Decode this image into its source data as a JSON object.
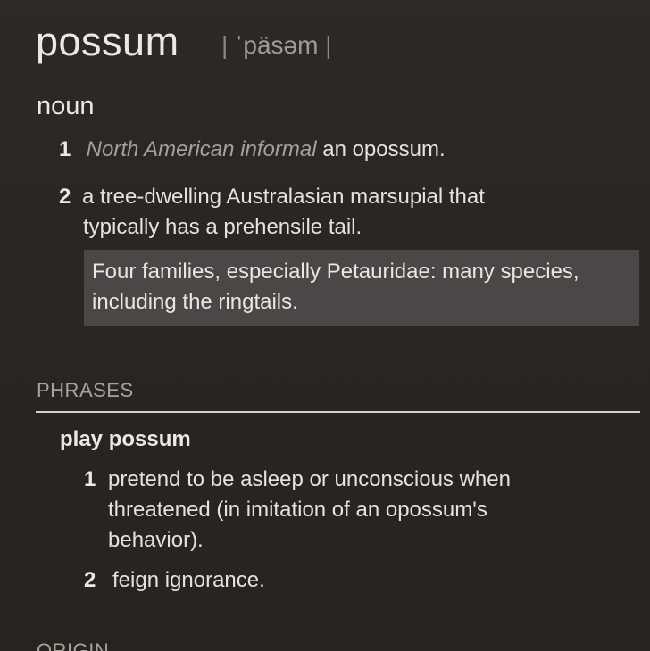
{
  "entry": {
    "headword": "possum",
    "pronunciation": "ˈpäsəm",
    "pronunciation_bar": "|",
    "part_of_speech": "noun"
  },
  "senses": [
    {
      "number": "1",
      "register_region": "North American",
      "register_style": "informal",
      "definition": "an opossum."
    },
    {
      "number": "2",
      "definition_line1": "a tree-dwelling Australasian marsupial that",
      "definition_line2": "typically has a prehensile tail.",
      "note": "Four families, especially Petauridae: many species, including the ringtails."
    }
  ],
  "phrases_section": {
    "heading": "PHRASES",
    "phrase": "play possum",
    "senses": [
      {
        "number": "1",
        "definition_line1": "pretend to be asleep or unconscious when",
        "definition_line2": "threatened (in imitation of an opossum's",
        "definition_line3": "behavior)."
      },
      {
        "number": "2",
        "definition": "feign ignorance."
      }
    ]
  },
  "origin_section": {
    "heading": "ORIGIN"
  }
}
